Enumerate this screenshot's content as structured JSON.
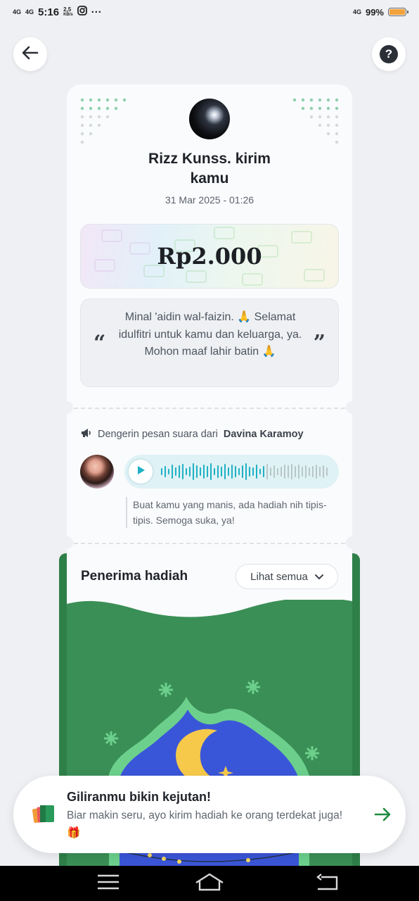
{
  "status_bar": {
    "network1": "4G",
    "network2": "4G",
    "time": "5:16",
    "speed": "2,5",
    "speed_unit": "KB/s",
    "more": "···",
    "battery_network": "4G",
    "battery_percent": "99%",
    "battery_level": 0.99
  },
  "header": {
    "back_icon": "arrow-left-icon",
    "help_label": "?"
  },
  "gift": {
    "sender_line": "Rizz Kunss. kirim kamu",
    "date": "31 Mar 2025 - 01:26",
    "amount": "Rp2.000",
    "message": "Minal 'aidin wal-faizin. 🙏 Selamat idulfitri untuk kamu dan keluarga, ya. Mohon maaf lahir batin 🙏",
    "quote_open": "“",
    "quote_close": "”"
  },
  "voice": {
    "label_prefix": "Dengerin pesan suara dari",
    "label_name": "Davina Karamoy",
    "caption": "Buat kamu yang manis, ada hadiah nih tipis-tipis. Semoga suka, ya!",
    "progress": 0.0
  },
  "recipients": {
    "title": "Penerima hadiah",
    "see_all": "Lihat semua"
  },
  "promo": {
    "title": "Giliranmu bikin kejutan!",
    "text": "Biar makin seru, ayo kirim hadiah ke orang terdekat juga! 🎁"
  },
  "colors": {
    "accent_green": "#2f7f49",
    "audio_teal": "#1fb0c4",
    "background": "#eef0f3"
  }
}
